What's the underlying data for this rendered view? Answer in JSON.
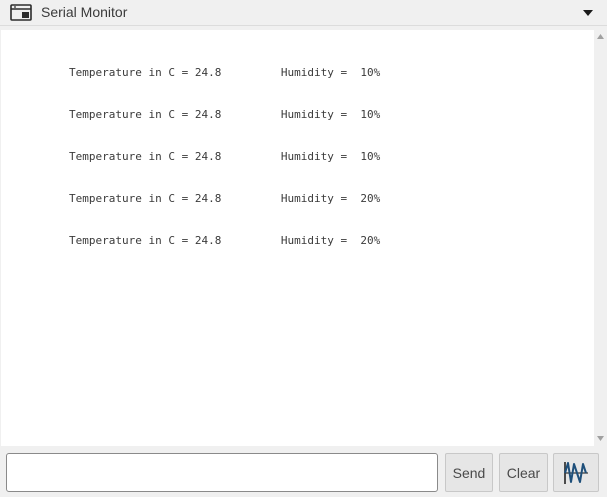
{
  "window": {
    "title": "Serial Monitor",
    "title_icon": "serial-monitor-window-icon",
    "dropdown_icon": "caret-down-icon"
  },
  "output": {
    "lines": [
      "Temperature in C = 24.8         Humidity =  10%",
      "Temperature in C = 24.8         Humidity =  10%",
      "Temperature in C = 24.8         Humidity =  10%",
      "Temperature in C = 24.8         Humidity =  20%",
      "Temperature in C = 24.8         Humidity =  20%"
    ]
  },
  "input": {
    "value": "",
    "placeholder": ""
  },
  "buttons": {
    "send_label": "Send",
    "clear_label": "Clear",
    "plotter_icon": "serial-plotter-waveform-icon"
  },
  "colors": {
    "background": "#f0f0f0",
    "output_background": "#ffffff",
    "text": "#3a3a3a",
    "button_background": "#e6e6e6"
  }
}
